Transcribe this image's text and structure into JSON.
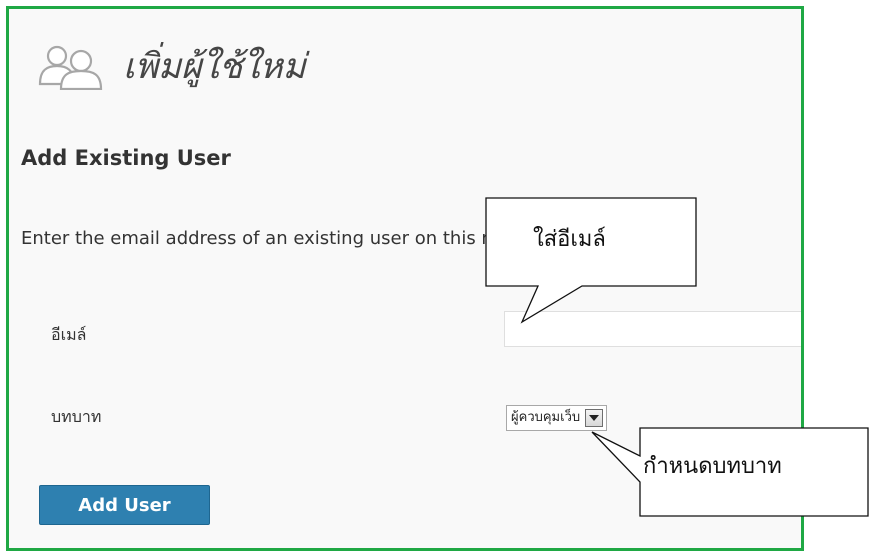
{
  "header": {
    "title": "เพิ่มผู้ใช้ใหม่",
    "icon": "users-icon"
  },
  "section": {
    "heading": "Add Existing User",
    "description": "Enter the email address of an existing user on this network to invite."
  },
  "form": {
    "email_label": "อีเมล์",
    "email_value": "",
    "role_label": "บทบาท",
    "role_value": "ผู้ควบคุมเว็บ",
    "submit_label": "Add User"
  },
  "annotations": {
    "email_callout": "ใส่อีเมล์",
    "role_callout": "กำหนดบทบาท"
  },
  "colors": {
    "frame_border": "#1fa844",
    "button": "#2e80b0",
    "background": "#f9f9f9"
  }
}
